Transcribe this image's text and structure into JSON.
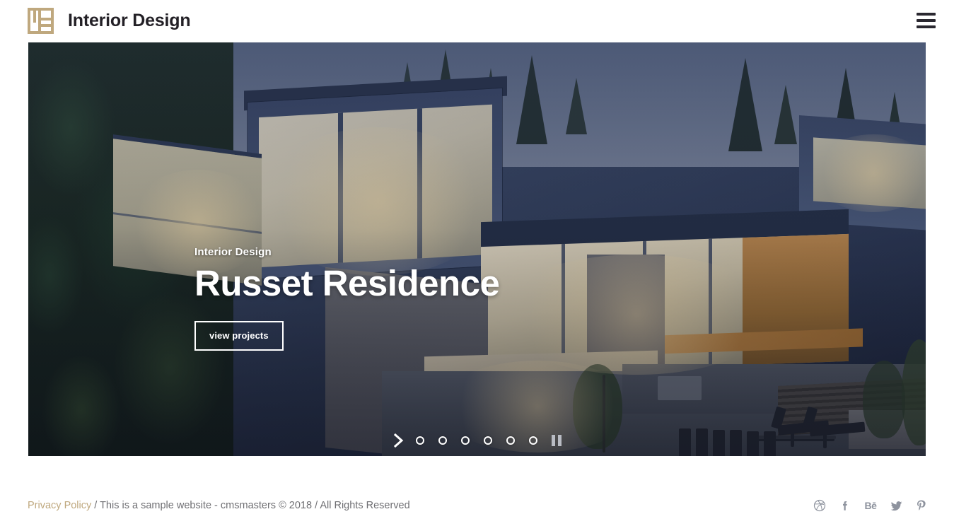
{
  "header": {
    "logo_icon": "interior-design-logo-mark",
    "brand_title": "Interior Design",
    "menu_icon": "hamburger-menu-icon",
    "logo_color": "#bfa87e",
    "title_color": "#232026"
  },
  "hero": {
    "subtitle": "Interior Design",
    "title": "Russet Residence",
    "button_label": "view projects",
    "image_description": "modern glass and concrete hillside house at dusk with forest and outdoor patio",
    "controls": {
      "next_icon": "chevron-right-icon",
      "pause_icon": "pause-icon",
      "dot_icon": "slide-dot-icon",
      "slide_count": 6,
      "active_slide": 1
    }
  },
  "footer": {
    "privacy_label": "Privacy Policy",
    "copyright": " / This is a sample website - cmsmasters © 2018 / All Rights Reserved",
    "privacy_color": "#bfa87e",
    "text_color": "#6f6f73",
    "social": [
      {
        "name": "dribbble",
        "icon": "dribbble-icon",
        "label": ""
      },
      {
        "name": "facebook",
        "icon": "facebook-icon",
        "label": "f"
      },
      {
        "name": "behance",
        "icon": "behance-icon",
        "label": "Bē"
      },
      {
        "name": "twitter",
        "icon": "twitter-icon",
        "label": ""
      },
      {
        "name": "pinterest",
        "icon": "pinterest-icon",
        "label": ""
      }
    ]
  }
}
